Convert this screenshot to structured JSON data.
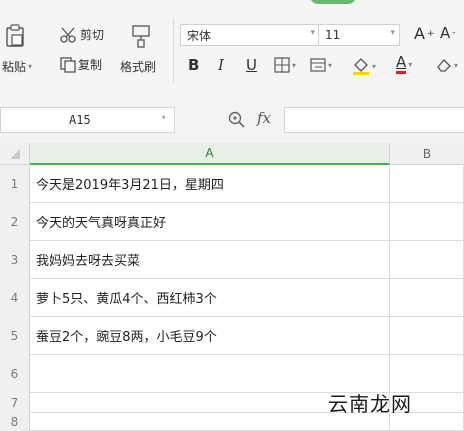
{
  "toolbar": {
    "paste_label": "粘贴",
    "cut_label": "剪切",
    "copy_label": "复制",
    "format_painter_label": "格式刷",
    "font_name": "宋体",
    "font_size": "11",
    "grow_font": "A",
    "shrink_font": "A",
    "bold": "B",
    "italic": "I",
    "underline": "U",
    "font_color_letter": "A",
    "accent_color": "#4caf50"
  },
  "formula_bar": {
    "cell_ref": "A15",
    "fx_label": "fx",
    "formula_value": ""
  },
  "sheet": {
    "columns": [
      "A",
      "B"
    ],
    "rows": [
      {
        "num": "1",
        "a": "今天是2019年3月21日，星期四"
      },
      {
        "num": "2",
        "a": "今天的天气真呀真正好"
      },
      {
        "num": "3",
        "a": "我妈妈去呀去买菜"
      },
      {
        "num": "4",
        "a": "萝卜5只、黄瓜4个、西红柿3个"
      },
      {
        "num": "5",
        "a": "蚕豆2个，豌豆8两，小毛豆9个"
      },
      {
        "num": "6",
        "a": ""
      },
      {
        "num": "7",
        "a": ""
      },
      {
        "num": "8",
        "a": ""
      }
    ]
  },
  "watermark": {
    "text": "云南龙网"
  }
}
